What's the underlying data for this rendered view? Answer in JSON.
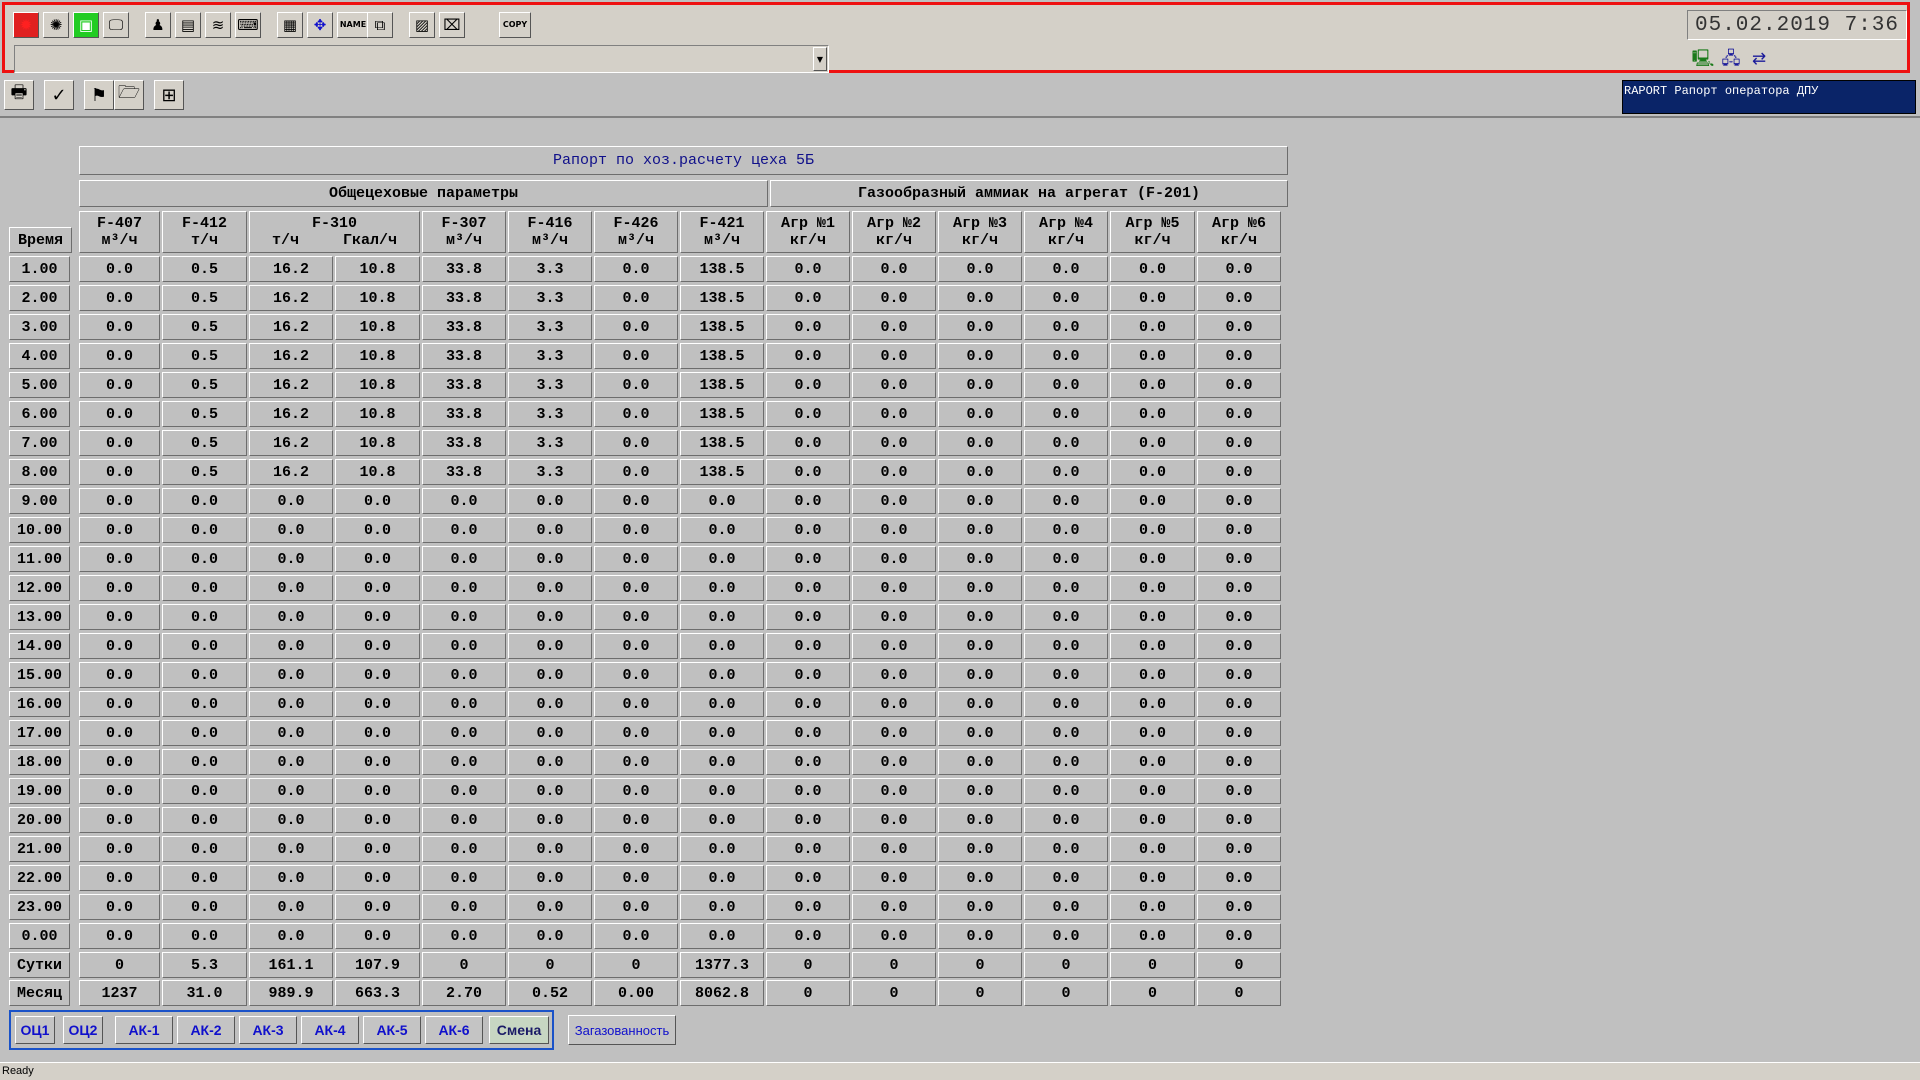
{
  "toolbar": {
    "icons": [
      {
        "name": "alarm-icon",
        "glyph": "✹",
        "color": "#ff2020",
        "bg": "#e02020"
      },
      {
        "name": "bug-icon",
        "glyph": "✺",
        "color": "#000000",
        "bg": "#d4d0c8"
      },
      {
        "name": "status-icon",
        "glyph": "▣",
        "color": "#ffffff",
        "bg": "#22cc22"
      },
      {
        "name": "monitor-icon",
        "glyph": "🖵",
        "color": "#000000",
        "bg": "#d4d0c8"
      },
      {
        "name": "operator-icon",
        "glyph": "♟",
        "color": "#000000",
        "bg": "#d4d0c8"
      },
      {
        "name": "panel-icon",
        "glyph": "▤",
        "color": "#000000",
        "bg": "#d4d0c8"
      },
      {
        "name": "trend-icon",
        "glyph": "≋",
        "color": "#000000",
        "bg": "#d4d0c8"
      },
      {
        "name": "keyboard-icon",
        "glyph": "⌨",
        "color": "#000000",
        "bg": "#d4d0c8"
      },
      {
        "name": "report-icon",
        "glyph": "▦",
        "color": "#000000",
        "bg": "#d4d0c8"
      },
      {
        "name": "navigate-icon",
        "glyph": "✥",
        "color": "#1010cc",
        "bg": "#d4d0c8"
      },
      {
        "name": "name-icon",
        "glyph": "NAME",
        "color": "#000000",
        "bg": "#d4d0c8",
        "small": true
      },
      {
        "name": "network-icon",
        "glyph": "⧉",
        "color": "#000000",
        "bg": "#d4d0c8"
      },
      {
        "name": "hatch-icon",
        "glyph": "▨",
        "color": "#000000",
        "bg": "#d4d0c8"
      },
      {
        "name": "no-draw-icon",
        "glyph": "⌧",
        "color": "#000000",
        "bg": "#d4d0c8"
      },
      {
        "name": "copy-icon",
        "glyph": "COPY",
        "color": "#000000",
        "bg": "#d4d0c8",
        "small": true
      }
    ],
    "datetime": "05.02.2019  7:36",
    "combo_value": ""
  },
  "toolbar2": {
    "icons": [
      {
        "name": "print-icon",
        "glyph": "🖶"
      },
      {
        "name": "check-icon",
        "glyph": "✓"
      },
      {
        "name": "flag-icon",
        "glyph": "⚑"
      },
      {
        "name": "open-folder-icon",
        "glyph": "🗁"
      },
      {
        "name": "add-window-icon",
        "glyph": "⊞"
      }
    ],
    "doc_title": "RAPORT Рапорт оператора ДПУ"
  },
  "report": {
    "title": "Рапорт по хоз.расчету цеха 5Б",
    "group_general": "Общецеховые параметры",
    "group_ammonia": "Газообразный аммиак на агрегат (F-201)",
    "time_header": "Время",
    "columns": [
      {
        "tag": "F-407",
        "unit": "м³/ч"
      },
      {
        "tag": "F-412",
        "unit": "т/ч"
      },
      {
        "tag": "F-310",
        "unit": "т/ч",
        "unit2": "Гкал/ч"
      },
      {
        "tag": "F-307",
        "unit": "м³/ч"
      },
      {
        "tag": "F-416",
        "unit": "м³/ч"
      },
      {
        "tag": "F-426",
        "unit": "м³/ч"
      },
      {
        "tag": "F-421",
        "unit": "м³/ч"
      },
      {
        "tag": "Агр №1",
        "unit": "кг/ч"
      },
      {
        "tag": "Агр №2",
        "unit": "кг/ч"
      },
      {
        "tag": "Агр №3",
        "unit": "кг/ч"
      },
      {
        "tag": "Агр №4",
        "unit": "кг/ч"
      },
      {
        "tag": "Агр №5",
        "unit": "кг/ч"
      },
      {
        "tag": "Агр №6",
        "unit": "кг/ч"
      }
    ],
    "rows": [
      {
        "time": "1.00",
        "values": [
          "0.0",
          "0.5",
          "16.2",
          "10.8",
          "33.8",
          "3.3",
          "0.0",
          "138.5",
          "0.0",
          "0.0",
          "0.0",
          "0.0",
          "0.0",
          "0.0"
        ]
      },
      {
        "time": "2.00",
        "values": [
          "0.0",
          "0.5",
          "16.2",
          "10.8",
          "33.8",
          "3.3",
          "0.0",
          "138.5",
          "0.0",
          "0.0",
          "0.0",
          "0.0",
          "0.0",
          "0.0"
        ]
      },
      {
        "time": "3.00",
        "values": [
          "0.0",
          "0.5",
          "16.2",
          "10.8",
          "33.8",
          "3.3",
          "0.0",
          "138.5",
          "0.0",
          "0.0",
          "0.0",
          "0.0",
          "0.0",
          "0.0"
        ]
      },
      {
        "time": "4.00",
        "values": [
          "0.0",
          "0.5",
          "16.2",
          "10.8",
          "33.8",
          "3.3",
          "0.0",
          "138.5",
          "0.0",
          "0.0",
          "0.0",
          "0.0",
          "0.0",
          "0.0"
        ]
      },
      {
        "time": "5.00",
        "values": [
          "0.0",
          "0.5",
          "16.2",
          "10.8",
          "33.8",
          "3.3",
          "0.0",
          "138.5",
          "0.0",
          "0.0",
          "0.0",
          "0.0",
          "0.0",
          "0.0"
        ]
      },
      {
        "time": "6.00",
        "values": [
          "0.0",
          "0.5",
          "16.2",
          "10.8",
          "33.8",
          "3.3",
          "0.0",
          "138.5",
          "0.0",
          "0.0",
          "0.0",
          "0.0",
          "0.0",
          "0.0"
        ]
      },
      {
        "time": "7.00",
        "values": [
          "0.0",
          "0.5",
          "16.2",
          "10.8",
          "33.8",
          "3.3",
          "0.0",
          "138.5",
          "0.0",
          "0.0",
          "0.0",
          "0.0",
          "0.0",
          "0.0"
        ]
      },
      {
        "time": "8.00",
        "values": [
          "0.0",
          "0.5",
          "16.2",
          "10.8",
          "33.8",
          "3.3",
          "0.0",
          "138.5",
          "0.0",
          "0.0",
          "0.0",
          "0.0",
          "0.0",
          "0.0"
        ]
      },
      {
        "time": "9.00",
        "values": [
          "0.0",
          "0.0",
          "0.0",
          "0.0",
          "0.0",
          "0.0",
          "0.0",
          "0.0",
          "0.0",
          "0.0",
          "0.0",
          "0.0",
          "0.0",
          "0.0"
        ]
      },
      {
        "time": "10.00",
        "values": [
          "0.0",
          "0.0",
          "0.0",
          "0.0",
          "0.0",
          "0.0",
          "0.0",
          "0.0",
          "0.0",
          "0.0",
          "0.0",
          "0.0",
          "0.0",
          "0.0"
        ]
      },
      {
        "time": "11.00",
        "values": [
          "0.0",
          "0.0",
          "0.0",
          "0.0",
          "0.0",
          "0.0",
          "0.0",
          "0.0",
          "0.0",
          "0.0",
          "0.0",
          "0.0",
          "0.0",
          "0.0"
        ]
      },
      {
        "time": "12.00",
        "values": [
          "0.0",
          "0.0",
          "0.0",
          "0.0",
          "0.0",
          "0.0",
          "0.0",
          "0.0",
          "0.0",
          "0.0",
          "0.0",
          "0.0",
          "0.0",
          "0.0"
        ]
      },
      {
        "time": "13.00",
        "values": [
          "0.0",
          "0.0",
          "0.0",
          "0.0",
          "0.0",
          "0.0",
          "0.0",
          "0.0",
          "0.0",
          "0.0",
          "0.0",
          "0.0",
          "0.0",
          "0.0"
        ]
      },
      {
        "time": "14.00",
        "values": [
          "0.0",
          "0.0",
          "0.0",
          "0.0",
          "0.0",
          "0.0",
          "0.0",
          "0.0",
          "0.0",
          "0.0",
          "0.0",
          "0.0",
          "0.0",
          "0.0"
        ]
      },
      {
        "time": "15.00",
        "values": [
          "0.0",
          "0.0",
          "0.0",
          "0.0",
          "0.0",
          "0.0",
          "0.0",
          "0.0",
          "0.0",
          "0.0",
          "0.0",
          "0.0",
          "0.0",
          "0.0"
        ]
      },
      {
        "time": "16.00",
        "values": [
          "0.0",
          "0.0",
          "0.0",
          "0.0",
          "0.0",
          "0.0",
          "0.0",
          "0.0",
          "0.0",
          "0.0",
          "0.0",
          "0.0",
          "0.0",
          "0.0"
        ]
      },
      {
        "time": "17.00",
        "values": [
          "0.0",
          "0.0",
          "0.0",
          "0.0",
          "0.0",
          "0.0",
          "0.0",
          "0.0",
          "0.0",
          "0.0",
          "0.0",
          "0.0",
          "0.0",
          "0.0"
        ]
      },
      {
        "time": "18.00",
        "values": [
          "0.0",
          "0.0",
          "0.0",
          "0.0",
          "0.0",
          "0.0",
          "0.0",
          "0.0",
          "0.0",
          "0.0",
          "0.0",
          "0.0",
          "0.0",
          "0.0"
        ]
      },
      {
        "time": "19.00",
        "values": [
          "0.0",
          "0.0",
          "0.0",
          "0.0",
          "0.0",
          "0.0",
          "0.0",
          "0.0",
          "0.0",
          "0.0",
          "0.0",
          "0.0",
          "0.0",
          "0.0"
        ]
      },
      {
        "time": "20.00",
        "values": [
          "0.0",
          "0.0",
          "0.0",
          "0.0",
          "0.0",
          "0.0",
          "0.0",
          "0.0",
          "0.0",
          "0.0",
          "0.0",
          "0.0",
          "0.0",
          "0.0"
        ]
      },
      {
        "time": "21.00",
        "values": [
          "0.0",
          "0.0",
          "0.0",
          "0.0",
          "0.0",
          "0.0",
          "0.0",
          "0.0",
          "0.0",
          "0.0",
          "0.0",
          "0.0",
          "0.0",
          "0.0"
        ]
      },
      {
        "time": "22.00",
        "values": [
          "0.0",
          "0.0",
          "0.0",
          "0.0",
          "0.0",
          "0.0",
          "0.0",
          "0.0",
          "0.0",
          "0.0",
          "0.0",
          "0.0",
          "0.0",
          "0.0"
        ]
      },
      {
        "time": "23.00",
        "values": [
          "0.0",
          "0.0",
          "0.0",
          "0.0",
          "0.0",
          "0.0",
          "0.0",
          "0.0",
          "0.0",
          "0.0",
          "0.0",
          "0.0",
          "0.0",
          "0.0"
        ]
      },
      {
        "time": "0.00",
        "values": [
          "0.0",
          "0.0",
          "0.0",
          "0.0",
          "0.0",
          "0.0",
          "0.0",
          "0.0",
          "0.0",
          "0.0",
          "0.0",
          "0.0",
          "0.0",
          "0.0"
        ]
      }
    ],
    "totals": [
      {
        "label": "Сутки",
        "values": [
          "0",
          "5.3",
          "161.1",
          "107.9",
          "0",
          "0",
          "0",
          "1377.3",
          "0",
          "0",
          "0",
          "0",
          "0",
          "0"
        ]
      },
      {
        "label": "Месяц",
        "values": [
          "1237",
          "31.0",
          "989.9",
          "663.3",
          "2.70",
          "0.52",
          "0.00",
          "8062.8",
          "0",
          "0",
          "0",
          "0",
          "0",
          "0"
        ]
      }
    ]
  },
  "tabs": [
    {
      "label": "ОЦ1",
      "active": false
    },
    {
      "label": "ОЦ2",
      "active": false
    },
    {
      "label": "АК-1",
      "active": false
    },
    {
      "label": "АК-2",
      "active": false
    },
    {
      "label": "АК-3",
      "active": false
    },
    {
      "label": "АК-4",
      "active": false
    },
    {
      "label": "АК-5",
      "active": false
    },
    {
      "label": "АК-6",
      "active": false
    },
    {
      "label": "Смена",
      "active": true
    }
  ],
  "gas_button": "Загазованность",
  "status": "Ready"
}
